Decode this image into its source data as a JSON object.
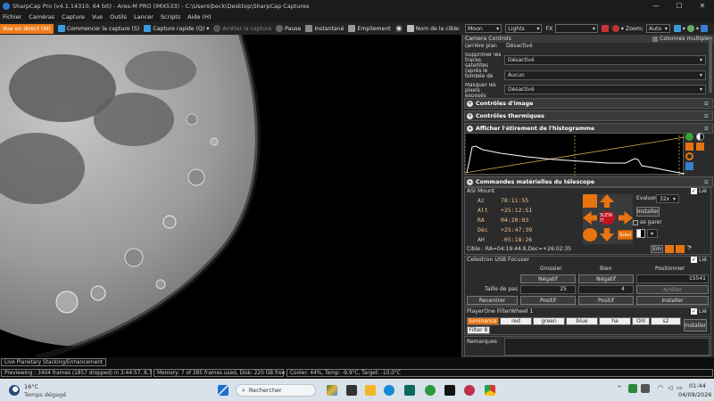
{
  "window": {
    "title": "SharpCap Pro (v4.1.14310, 64 bit) - Ares-M PRO (IMX533) - C:\\Users\\beck\\Desktop\\SharpCap Captures"
  },
  "menu": [
    "Fichier",
    "Caméras",
    "Capture",
    "Vue",
    "Outils",
    "Lancer",
    "Scripts",
    "Aide (H)"
  ],
  "toolbar": {
    "live": "Vue en direct (W)",
    "start": "Commencer la capture (S)",
    "quick": "Capture rapide (Q)",
    "stop": "Arrêter la capture",
    "pause": "Pause",
    "snapshot": "Instantané",
    "stack": "Empilement",
    "target_label": "Nom de la cible:",
    "target_value": "Moon",
    "frame_type": "Lights",
    "fx_label": "FX",
    "zoom_label": "Zoom:",
    "zoom_value": "Auto"
  },
  "panel": {
    "title": "Camera Controls",
    "multi": "Colonnes multiples",
    "rows": [
      {
        "label": "(arrière plan",
        "value": "Désactivé"
      },
      {
        "label": "Supprimer les traces satellites (après le tombée de la nuit/ciel)",
        "value": "Désactivé"
      },
      {
        "label": "(apres le tombée de",
        "value": "Aucun"
      },
      {
        "label": "Masquer les pixels exposés",
        "value": "Désactivé"
      }
    ],
    "sections": {
      "image": "Contrôles d'image",
      "thermal": "Contrôles thermiques",
      "histogram": "Afficher l'étirement de l'histogramme",
      "telescope": "Commandes matérielles du télescope"
    },
    "mount": {
      "name": "ASI Mount",
      "linked": "Lié",
      "az_label": "Az",
      "az": "78:11:55",
      "alt_label": "Alt",
      "alt": "+25:12:51",
      "ra_label": "RA",
      "ra": "04:20:03",
      "dec_label": "Déc",
      "dec": "+25:47:39",
      "ah_label": "AH",
      "ah": "-05:18:26",
      "slew": "SLEW IT",
      "track": "Suivi",
      "rate_label": "Evaluer:",
      "rate_value": "32x",
      "install": "Installer",
      "park": "se garer",
      "target": "Cible : RA=04:19:44.8,Dec=+26:02:35",
      "goto": "Em"
    },
    "focuser": {
      "name": "Celestron USB Focuser",
      "linked": "Lié",
      "coarse": "Grossier",
      "fine": "Bien",
      "position": "Positionner",
      "negative": "Négatif",
      "position_value": "15541",
      "step_label": "Taille de pas",
      "coarse_step": "25",
      "fine_step": "4",
      "stop": "Arrêter",
      "recenter": "Recentrer",
      "positive": "Positif",
      "install": "Installer"
    },
    "filter": {
      "name": "PlayerOne FilterWheel 1",
      "linked": "Lié",
      "filters": [
        "luminance",
        "red",
        "green",
        "blue",
        "ha",
        "OIII",
        "s2"
      ],
      "slot": "Filter 8",
      "install": "Installer"
    },
    "notes": "Remarques"
  },
  "status": {
    "stacking": "Live Planetary Stacking/Enhancement",
    "preview": "Previewing : 3404 frames (1857 dropped) in 3:44:57, 8,7 fps",
    "memory": "Memory: 7 of 385 frames used, Disk: 220 GB free",
    "cooler": "Cooler: 44%, Temp: -9,9°C, Target: -10,0°C"
  },
  "taskbar": {
    "temp": "16°C",
    "weather": "Temps dégagé",
    "search": "Rechercher",
    "time": "01:44",
    "date": "04/09/2026"
  },
  "colors": {
    "accent": "#e8740f",
    "panel": "#2b2b2b"
  }
}
